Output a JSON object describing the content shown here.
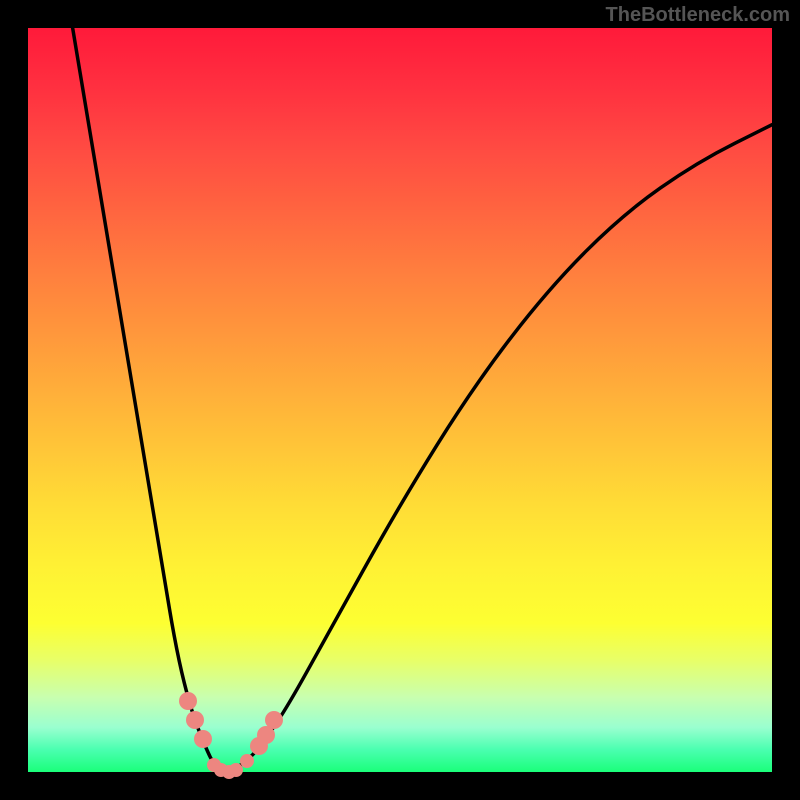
{
  "watermark": "TheBottleneck.com",
  "chart_data": {
    "type": "line",
    "title": "",
    "xlabel": "",
    "ylabel": "",
    "xlim": [
      0,
      100
    ],
    "ylim": [
      0,
      100
    ],
    "grid": false,
    "series": [
      {
        "name": "left-curve",
        "x": [
          6,
          8,
          10,
          12,
          15,
          18,
          20,
          22,
          24,
          25,
          26,
          27
        ],
        "y": [
          100,
          88,
          76,
          64,
          46,
          28,
          16,
          8,
          3,
          1,
          0,
          0
        ]
      },
      {
        "name": "right-curve",
        "x": [
          27,
          28,
          30,
          32,
          35,
          40,
          50,
          60,
          70,
          80,
          90,
          100
        ],
        "y": [
          0,
          0.5,
          2,
          4.5,
          9,
          18,
          36,
          52,
          65,
          75,
          82,
          87
        ]
      }
    ],
    "markers": [
      {
        "x": 21.5,
        "y": 9.5
      },
      {
        "x": 22.5,
        "y": 7
      },
      {
        "x": 23.5,
        "y": 4.5
      },
      {
        "x": 25,
        "y": 1
      },
      {
        "x": 26,
        "y": 0.3
      },
      {
        "x": 27,
        "y": 0
      },
      {
        "x": 28,
        "y": 0.3
      },
      {
        "x": 29.5,
        "y": 1.5
      },
      {
        "x": 31,
        "y": 3.5
      },
      {
        "x": 32,
        "y": 5
      },
      {
        "x": 33,
        "y": 7
      }
    ],
    "background_gradient": {
      "top": "#ff1a3a",
      "bottom": "#1aff7a"
    }
  }
}
